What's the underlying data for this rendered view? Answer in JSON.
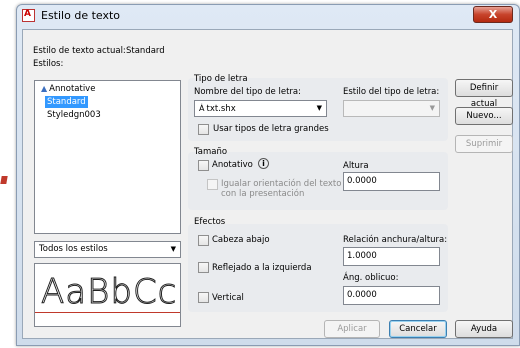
{
  "window": {
    "title": "Estilo de texto",
    "close_glyph": "X"
  },
  "current_style": {
    "label": "Estilo de texto actual:",
    "value": "Standard"
  },
  "styles": {
    "label": "Estilos:",
    "items": [
      {
        "label": "Annotative",
        "icon": "annotative-icon"
      },
      {
        "label": "Standard",
        "selected": true
      },
      {
        "label": "Styledgn003"
      }
    ],
    "filter": {
      "value": "Todos los estilos"
    }
  },
  "preview": {
    "text": "AaBbCc"
  },
  "font": {
    "group_label": "Tipo de letra",
    "name_label": "Nombre del tipo de letra:",
    "name_value": "txt.shx",
    "style_label": "Estilo del tipo de letra:",
    "style_value": "",
    "use_big_font": "Usar tipos de letra grandes"
  },
  "size": {
    "group_label": "Tamaño",
    "annotative": "Anotativo",
    "match_orientation_line1": "Igualar orientación del texto",
    "match_orientation_line2": "con la presentación",
    "height_label": "Altura",
    "height_value": "0.0000"
  },
  "effects": {
    "group_label": "Efectos",
    "upside_down": "Cabeza abajo",
    "backwards": "Reflejado a la izquierda",
    "vertical": "Vertical",
    "width_factor_label": "Relación anchura/altura:",
    "width_factor_value": "1.0000",
    "oblique_label": "Áng. oblicuo:",
    "oblique_value": "0.0000"
  },
  "buttons": {
    "set_current": "Definir actual",
    "new": "Nuevo...",
    "delete": "Suprimir",
    "apply": "Aplicar",
    "cancel": "Cancelar",
    "help": "Ayuda"
  }
}
